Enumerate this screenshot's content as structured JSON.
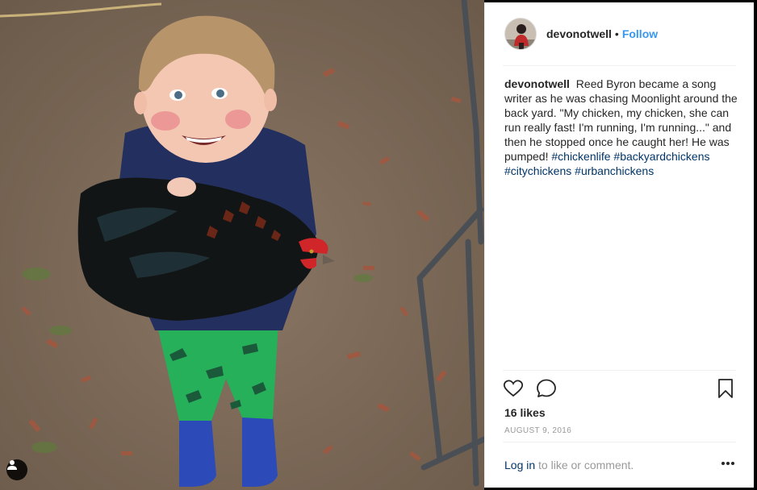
{
  "post": {
    "username": "devonotwell",
    "follow_separator": "•",
    "follow_label": "Follow",
    "caption_user": "devonotwell",
    "caption_text": "Reed Byron became a song writer as he was chasing Moonlight around the back yard. \"My chicken, my chicken, she can run really fast! I'm running, I'm running...\" and then he stopped once he caught her! He was pumped!",
    "hashtags": [
      "#chickenlife",
      "#backyardchickens",
      "#citychickens",
      "#urbanchickens"
    ],
    "likes": "16 likes",
    "date": "AUGUST 9, 2016",
    "login_link": "Log in",
    "login_text": "to like or comment.",
    "more_label": "•••"
  },
  "icons": {
    "like": "heart-icon",
    "comment": "comment-icon",
    "save": "bookmark-icon",
    "more": "more-options-icon",
    "user_tag": "user-tag-icon"
  },
  "colors": {
    "link_blue": "#3897f0",
    "hashtag": "#003569",
    "text": "#262626",
    "muted": "#999999"
  }
}
